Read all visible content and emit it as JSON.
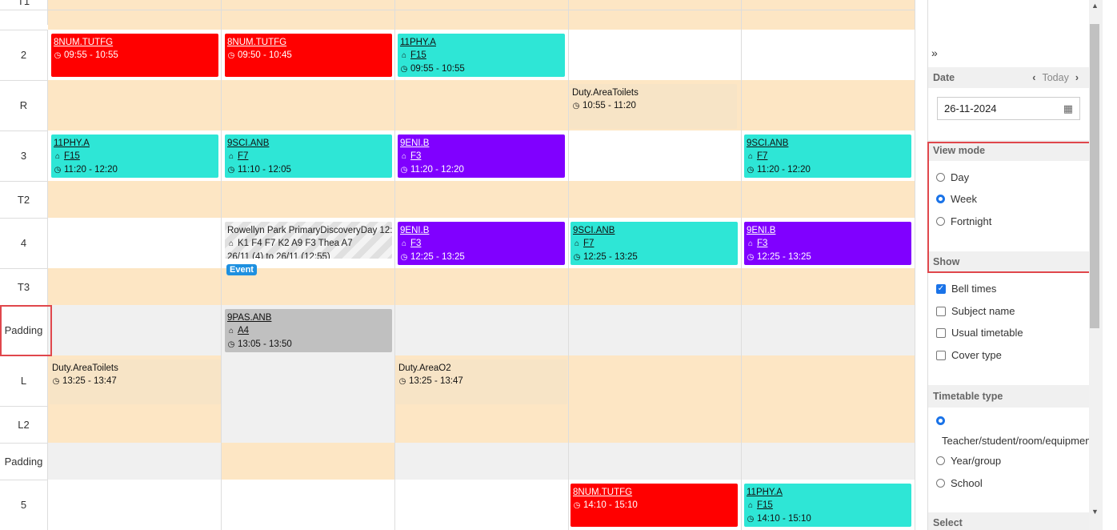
{
  "rows": [
    {
      "label": "T1"
    },
    {
      "label": "2"
    },
    {
      "label": "R"
    },
    {
      "label": "3"
    },
    {
      "label": "T2"
    },
    {
      "label": "4"
    },
    {
      "label": "T3"
    },
    {
      "label": "Padding"
    },
    {
      "label": "L"
    },
    {
      "label": "L2"
    },
    {
      "label": "Padding"
    },
    {
      "label": "5"
    }
  ],
  "events": {
    "e2a": {
      "code": "8NUM.TUTFG",
      "time": "09:55 - 10:55"
    },
    "e2b": {
      "code": "8NUM.TUTFG",
      "time": "09:50 - 10:45"
    },
    "e2c": {
      "code": "11PHY.A",
      "room": "F15",
      "time": "09:55 - 10:55"
    },
    "eRd": {
      "code": "Duty.AreaToilets",
      "time": "10:55 - 11:20"
    },
    "e3a": {
      "code": "11PHY.A",
      "room": "F15",
      "time": "11:20 - 12:20"
    },
    "e3b": {
      "code": "9SCI.ANB",
      "room": "F7",
      "time": "11:10 - 12:05"
    },
    "e3c": {
      "code": "9ENI.B",
      "room": "F3",
      "time": "11:20 - 12:20"
    },
    "e3e": {
      "code": "9SCI.ANB",
      "room": "F7",
      "time": "11:20 - 12:20"
    },
    "e4b": {
      "title": "Rowellyn Park PrimaryDiscoveryDay 12:",
      "rooms": "K1 F4 F7 K2 A9 F3 Thea A7",
      "dates": "26/11 (4) to 26/11 (12:55)",
      "badge": "Event"
    },
    "e4c": {
      "code": "9ENI.B",
      "room": "F3",
      "time": "12:25 - 13:25"
    },
    "e4d": {
      "code": "9SCI.ANB",
      "room": "F7",
      "time": "12:25 - 13:25"
    },
    "e4e": {
      "code": "9ENI.B",
      "room": "F3",
      "time": "12:25 - 13:25"
    },
    "ePb": {
      "code": "9PAS.ANB",
      "room": "A4",
      "time": "13:05 - 13:50"
    },
    "eLa": {
      "code": "Duty.AreaToilets",
      "time": "13:25 - 13:47"
    },
    "eLc": {
      "code": "Duty.AreaO2",
      "time": "13:25 - 13:47"
    },
    "e5d": {
      "code": "8NUM.TUTFG",
      "time": "14:10 - 15:10"
    },
    "e5e": {
      "code": "11PHY.A",
      "room": "F15",
      "time": "14:10 - 15:10"
    }
  },
  "panel": {
    "collapse": "»",
    "date_label": "Date",
    "today": "Today",
    "date_value": "26-11-2024",
    "view_mode": {
      "title": "View mode",
      "options": [
        "Day",
        "Week",
        "Fortnight"
      ],
      "selected": "Week"
    },
    "show": {
      "title": "Show",
      "options": [
        {
          "label": "Bell times",
          "checked": true
        },
        {
          "label": "Subject name",
          "checked": false
        },
        {
          "label": "Usual timetable",
          "checked": false
        },
        {
          "label": "Cover type",
          "checked": false
        }
      ]
    },
    "timetable_type": {
      "title": "Timetable type",
      "options": [
        "Teacher/student/room/equipmen",
        "Year/group",
        "School"
      ],
      "selected": "Teacher/student/room/equipmen"
    },
    "next_section": "Select"
  },
  "colors": {
    "peach": "#fde6c4",
    "grey": "#f0f0f0",
    "red": "#ff0000",
    "cyan": "#2ee6d6",
    "purple": "#8000ff",
    "highlight": "#e0474c"
  }
}
